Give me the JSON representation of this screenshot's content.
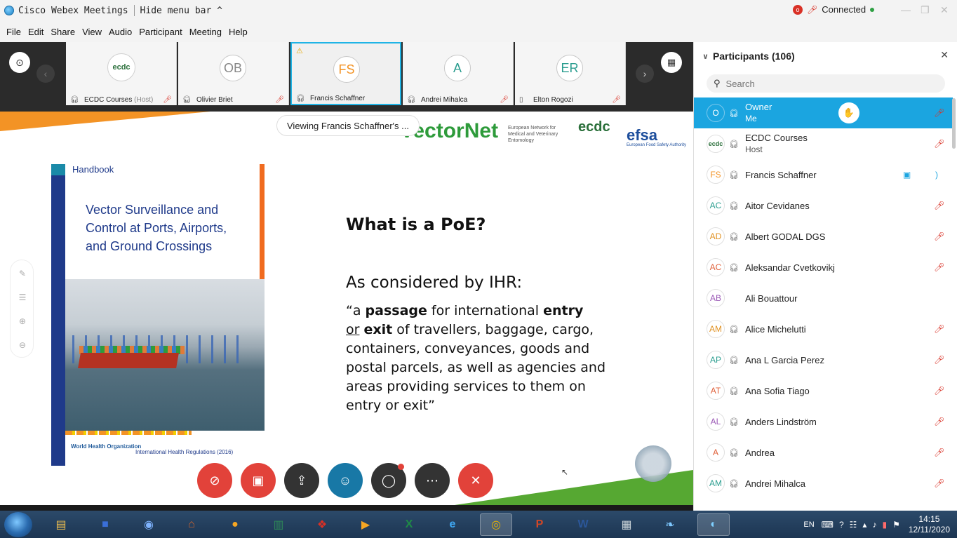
{
  "titlebar": {
    "app_title": "Cisco Webex Meetings",
    "hide_menu": "Hide menu bar ^",
    "status": "Connected"
  },
  "menu": [
    "File",
    "Edit",
    "Share",
    "View",
    "Audio",
    "Participant",
    "Meeting",
    "Help"
  ],
  "video_strip": {
    "tiles": [
      {
        "initials": "ecdc",
        "name": "ECDC Courses",
        "role": "(Host)"
      },
      {
        "initials": "OB",
        "name": "Olivier Briet",
        "role": ""
      },
      {
        "initials": "FS",
        "name": "Francis Schaffner",
        "role": ""
      },
      {
        "initials": "A",
        "name": "Andrei Mihalca",
        "role": ""
      },
      {
        "initials": "ER",
        "name": "Elton Rogozi",
        "role": ""
      }
    ]
  },
  "share": {
    "viewing_label": "Viewing Francis Schaffner's ...",
    "vectornet_logo": "VectorNet",
    "vectornet_sub": "European Network for Medical and Veterinary Entomology",
    "ecdc_logo": "ecdc",
    "efsa_logo": "efsa",
    "efsa_sub": "European Food Safety Authority",
    "book": {
      "handbook": "Handbook",
      "title": "Vector Surveillance and Control at Ports, Airports, and Ground Crossings",
      "who": "World Health Organization",
      "ihr": "International Health Regulations (2016)"
    },
    "slide": {
      "title": "What is a PoE?",
      "subtitle": "As considered by IHR:",
      "body_1": "“a ",
      "body_2": "passage",
      "body_3": " for international ",
      "body_4": "entry",
      "body_5": "or",
      "body_6": "exit",
      "body_7": " of travellers, baggage, cargo, containers, conveyances, goods and postal parcels, as well as agencies and areas providing services to them on entry or exit”"
    }
  },
  "participants": {
    "header": "Participants (106)",
    "search_placeholder": "Search",
    "list": [
      {
        "initials": "O",
        "name": "Owner",
        "sub": "Me",
        "muted": true,
        "selected": true
      },
      {
        "initials": "ecdc",
        "name": "ECDC Courses",
        "sub": "Host",
        "muted": true
      },
      {
        "initials": "FS",
        "name": "Francis Schaffner",
        "sub": "",
        "muted": false,
        "video": true
      },
      {
        "initials": "AC",
        "name": "Aitor Cevidanes",
        "sub": "",
        "muted": true
      },
      {
        "initials": "AD",
        "name": "Albert GODAL DGS",
        "sub": "",
        "muted": true
      },
      {
        "initials": "AC",
        "name": "Aleksandar Cvetkovikj",
        "sub": "",
        "muted": true
      },
      {
        "initials": "AB",
        "name": "Ali Bouattour",
        "sub": "",
        "muted": false
      },
      {
        "initials": "AM",
        "name": "Alice Michelutti",
        "sub": "",
        "muted": true
      },
      {
        "initials": "AP",
        "name": "Ana L Garcia Perez",
        "sub": "",
        "muted": true
      },
      {
        "initials": "AT",
        "name": "Ana Sofia Tiago",
        "sub": "",
        "muted": true
      },
      {
        "initials": "AL",
        "name": "Anders Lindström",
        "sub": "",
        "muted": true
      },
      {
        "initials": "A",
        "name": "Andrea",
        "sub": "",
        "muted": true
      },
      {
        "initials": "AM",
        "name": "Andrei Mihalca",
        "sub": "",
        "muted": true
      }
    ]
  },
  "taskbar": {
    "lang": "EN",
    "time": "14:15",
    "date": "12/11/2020"
  },
  "colors": {
    "accent": "#1ba5e0",
    "end_red": "#e2423a",
    "vectornet_green": "#2e9b3b"
  }
}
